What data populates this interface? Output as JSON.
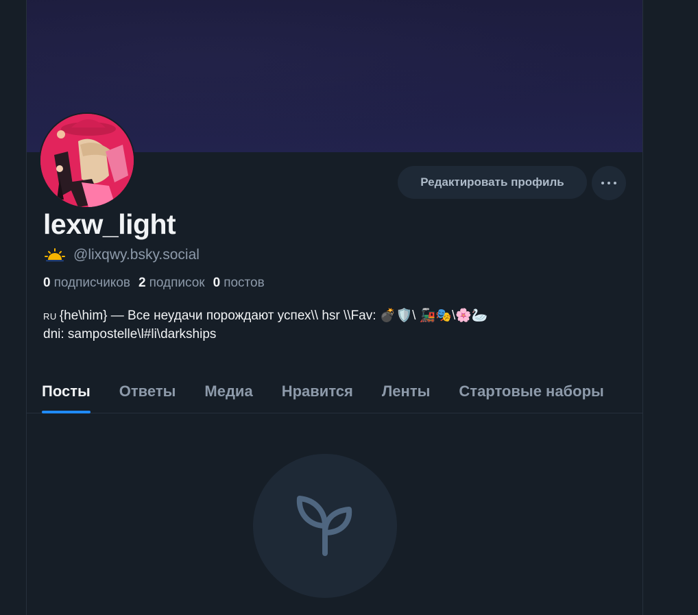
{
  "profile": {
    "display_name": "lexw_light",
    "handle": "@lixqwy.bsky.social",
    "handle_icon": "sunrise-icon",
    "stats": {
      "followers_count": "0",
      "followers_label": "подписчиков",
      "following_count": "2",
      "following_label": "подписок",
      "posts_count": "0",
      "posts_label": "постов"
    },
    "bio_prefix": "RU",
    "bio_line1": "{he\\him} — Все неудачи порождают успех\\\\ hsr \\\\Fav: 💣🛡️\\ 🚂🎭\\🌸🦢",
    "bio_line2": "dni: sampostelle\\l#li\\darkships"
  },
  "actions": {
    "edit_profile_label": "Редактировать профиль",
    "more_icon": "ellipsis-icon"
  },
  "tabs": [
    {
      "label": "Посты",
      "active": true
    },
    {
      "label": "Ответы",
      "active": false
    },
    {
      "label": "Медиа",
      "active": false
    },
    {
      "label": "Нравится",
      "active": false
    },
    {
      "label": "Ленты",
      "active": false
    },
    {
      "label": "Стартовые наборы",
      "active": false
    }
  ],
  "empty_state": {
    "icon": "sprout-icon"
  },
  "colors": {
    "background": "#161e27",
    "accent": "#208bfe",
    "button_bg": "#1e2936",
    "muted_text": "#8d9aaa"
  }
}
